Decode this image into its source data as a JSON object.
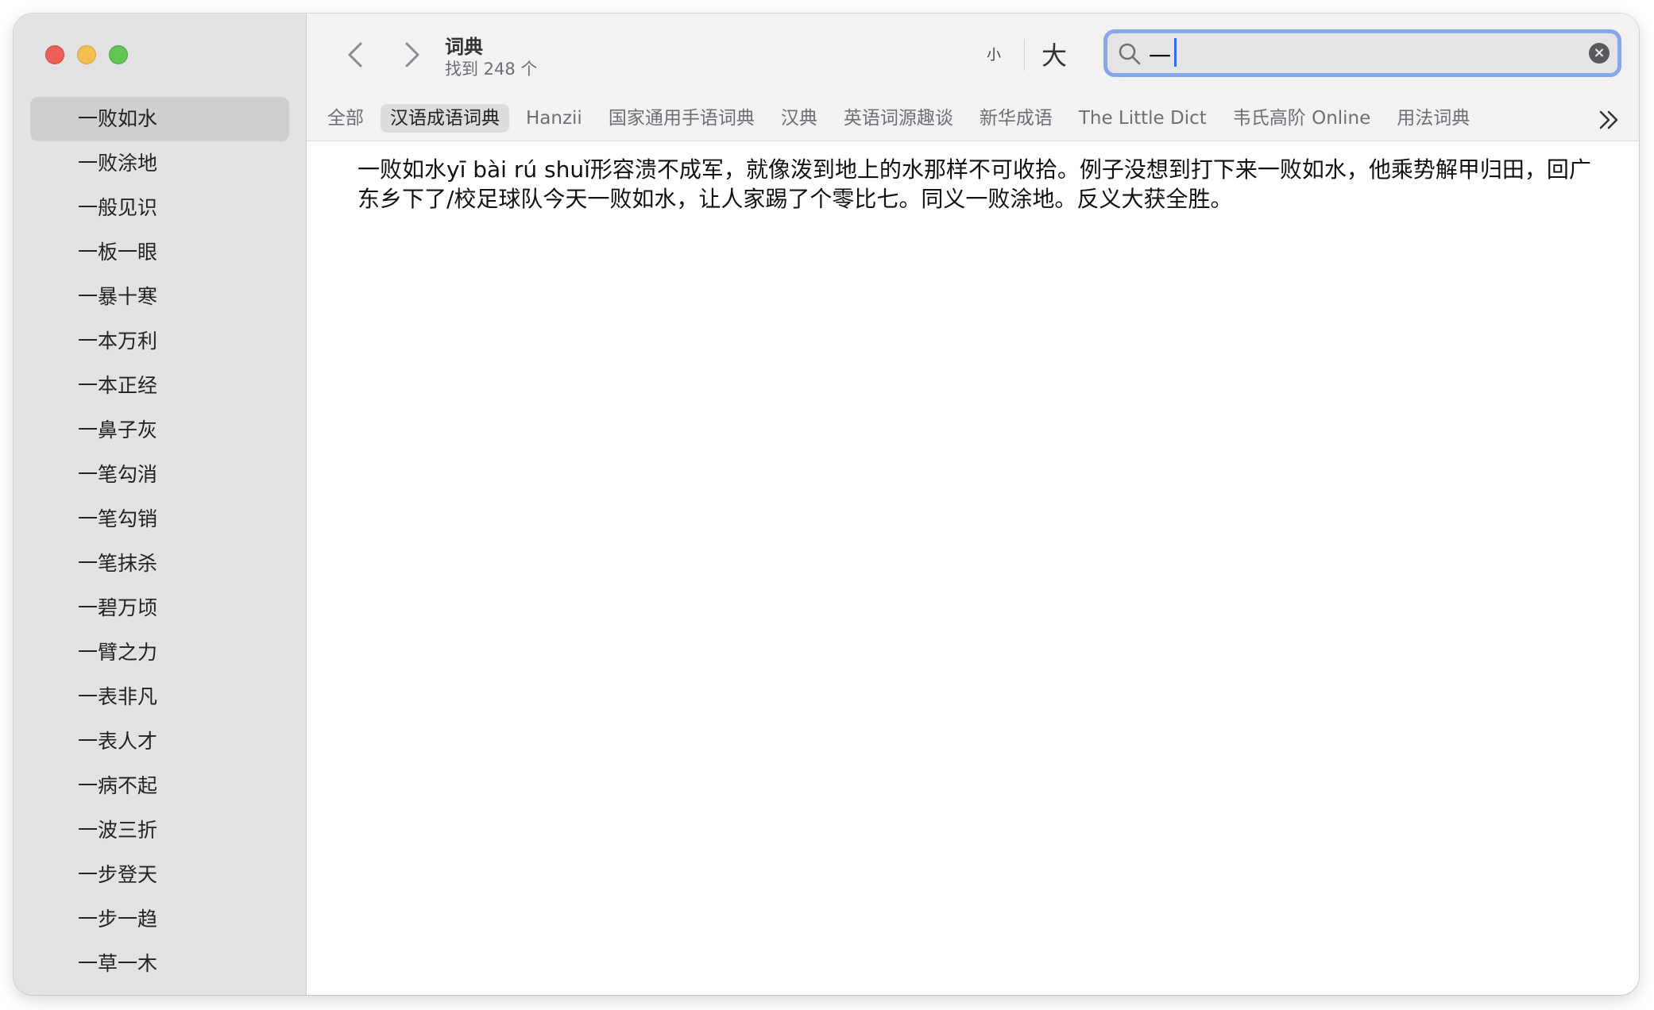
{
  "window": {
    "title": "词典",
    "result_count": "找到 248 个"
  },
  "toolbar": {
    "font_small_label": "小",
    "font_large_label": "大",
    "search_value": "一"
  },
  "tabs": [
    {
      "label": "全部",
      "selected": false
    },
    {
      "label": "汉语成语词典",
      "selected": true
    },
    {
      "label": "Hanzii",
      "selected": false
    },
    {
      "label": "国家通用手语词典",
      "selected": false
    },
    {
      "label": "汉典",
      "selected": false
    },
    {
      "label": "英语词源趣谈",
      "selected": false
    },
    {
      "label": "新华成语",
      "selected": false
    },
    {
      "label": "The Little Dict",
      "selected": false
    },
    {
      "label": "韦氏高阶 Online",
      "selected": false
    },
    {
      "label": "用法词典",
      "selected": false
    }
  ],
  "sidebar": {
    "items": [
      "一败如水",
      "一败涂地",
      "一般见识",
      "一板一眼",
      "一暴十寒",
      "一本万利",
      "一本正经",
      "一鼻子灰",
      "一笔勾消",
      "一笔勾销",
      "一笔抹杀",
      "一碧万顷",
      "一臂之力",
      "一表非凡",
      "一表人才",
      "一病不起",
      "一波三折",
      "一步登天",
      "一步一趋",
      "一草一木"
    ],
    "selected_index": 0
  },
  "entry": {
    "text": "一败如水yī bài rú shuǐ形容溃不成军，就像泼到地上的水那样不可收拾。例子没想到打下来一败如水，他乘势解甲归田，回广东乡下了/校足球队今天一败如水，让人家踢了个零比七。同义一败涂地。反义大获全胜。"
  },
  "colors": {
    "sidebar_bg": "#e2e2e4",
    "toolbar_bg": "#f2f2f4",
    "selection_bg": "#cfcfd2",
    "search_focus_ring": "#86a8ea",
    "caret": "#2f6de6",
    "close_button": "#ee5f57",
    "minimize_button": "#f4be4f",
    "zoom_button": "#61c454"
  }
}
